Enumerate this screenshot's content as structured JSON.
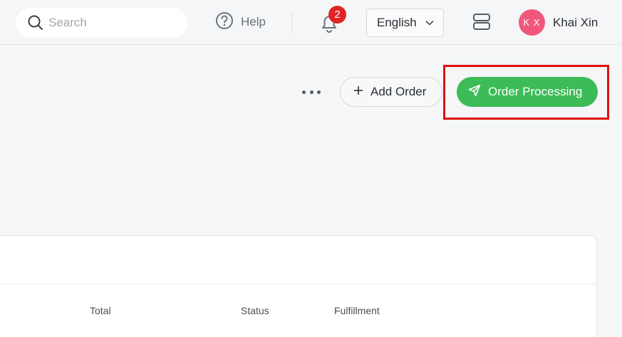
{
  "topbar": {
    "search": {
      "placeholder": "Search",
      "icon": "search-icon"
    },
    "help": {
      "label": "Help",
      "icon": "question-circle-icon"
    },
    "notifications": {
      "icon": "bell-icon",
      "count": "2"
    },
    "language": {
      "selected": "English",
      "icon": "chevron-down-icon"
    },
    "server_icon": "server-icon",
    "user": {
      "initials": "K X",
      "name": "Khai Xin",
      "avatar_color": "#f0577a"
    }
  },
  "actions": {
    "more_icon": "more-horizontal-icon",
    "add_order": {
      "label": "Add Order",
      "icon": "plus-icon"
    },
    "order_processing": {
      "label": "Order Processing",
      "icon": "send-icon",
      "color": "#3dbb56"
    },
    "highlight_color": "#e01010"
  },
  "table": {
    "columns": [
      "Total",
      "Status",
      "Fulfillment"
    ]
  }
}
